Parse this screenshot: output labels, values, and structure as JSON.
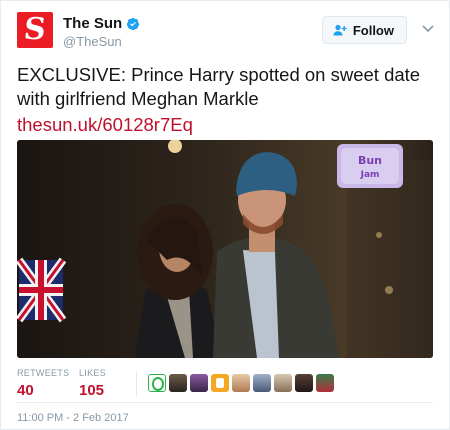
{
  "account": {
    "display_name": "The Sun",
    "handle": "@TheSun",
    "verified": true,
    "logo_letter": "S",
    "logo_color": "#ec1c24"
  },
  "follow_button": {
    "label": "Follow",
    "icon": "add-user-icon"
  },
  "menu_icon": "chevron-down-icon",
  "tweet": {
    "text_line1": "EXCLUSIVE: Prince Harry spotted on sweet date",
    "text_line2": "with girlfriend Meghan Markle",
    "link": "thesun.uk/60128r7Eq"
  },
  "photo": {
    "sign_text_top": "Bun",
    "sign_text_bottom": "Jam"
  },
  "stats": {
    "retweets_label": "RETWEETS",
    "retweets_value": "40",
    "likes_label": "LIKES",
    "likes_value": "105"
  },
  "timestamp": "11:00 PM - 2 Feb 2017",
  "colors": {
    "accent": "#c0102d",
    "muted": "#8899a6",
    "verified": "#1da1f2"
  }
}
